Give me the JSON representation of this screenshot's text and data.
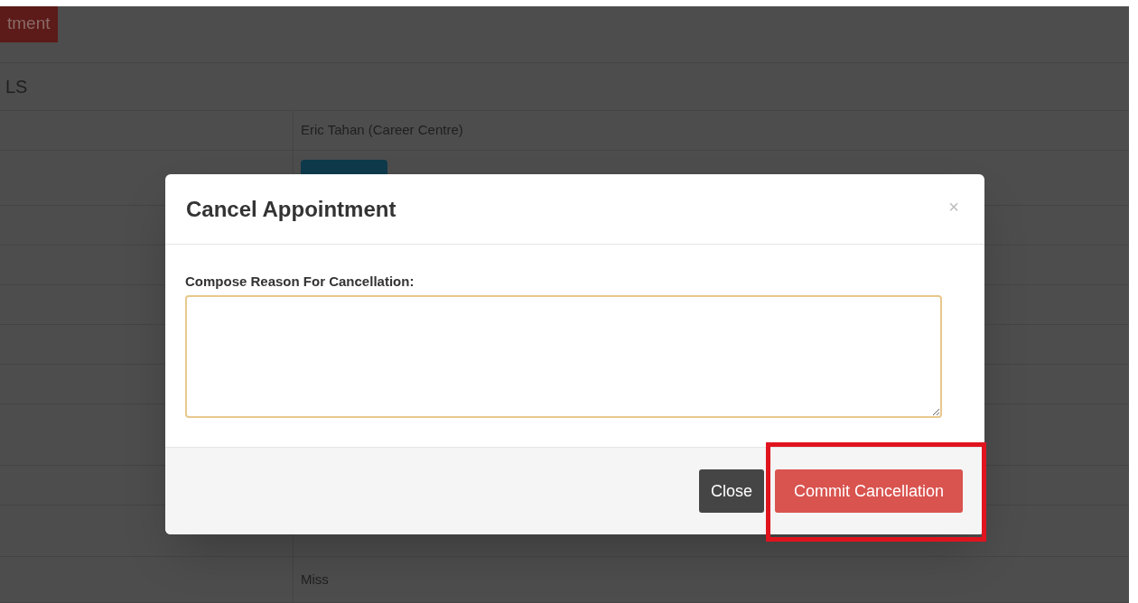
{
  "page": {
    "header_button": "tment",
    "section_heading": "LS",
    "rows": [
      {
        "kind": "text",
        "value": "Eric Tahan (Career Centre)"
      },
      {
        "kind": "badge"
      },
      {
        "kind": "blank"
      },
      {
        "kind": "blank"
      },
      {
        "kind": "blank"
      },
      {
        "kind": "blank"
      },
      {
        "kind": "blank"
      },
      {
        "kind": "blank"
      },
      {
        "kind": "blank"
      },
      {
        "kind": "blank"
      },
      {
        "kind": "text",
        "value": "Miss"
      }
    ]
  },
  "modal": {
    "title": "Cancel Appointment",
    "close": "×",
    "label": "Compose Reason For Cancellation:",
    "buttons": [
      {
        "label": "Close",
        "kind": "secondary",
        "highlighted": false
      },
      {
        "label": "Commit Cancellation",
        "kind": "danger",
        "highlighted": true
      }
    ]
  }
}
